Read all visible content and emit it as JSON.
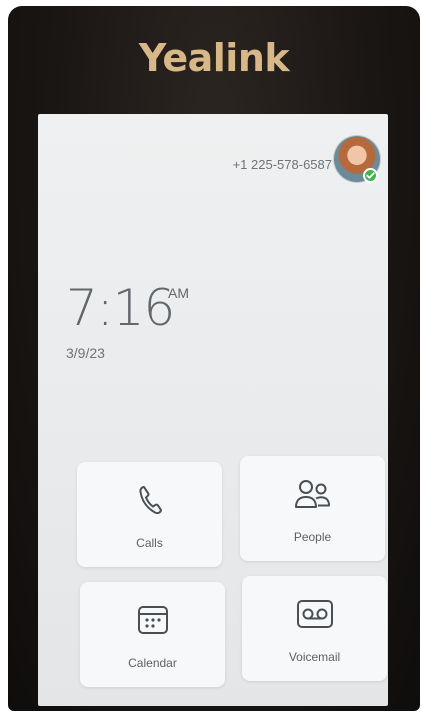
{
  "device": {
    "brand": "Yealink"
  },
  "status_bar": {
    "phone_number": "+1 225-578-6587",
    "presence": "available"
  },
  "clock": {
    "time": "7:16",
    "ampm": "AM",
    "date": "3/9/23"
  },
  "tiles": [
    {
      "label": "Calls",
      "icon": "phone-icon"
    },
    {
      "label": "People",
      "icon": "people-icon"
    },
    {
      "label": "Calendar",
      "icon": "calendar-icon"
    },
    {
      "label": "Voicemail",
      "icon": "voicemail-icon"
    }
  ],
  "colors": {
    "brand_gold": "#d8b889",
    "presence_green": "#3fb54a",
    "screen_bg": "#eef0f1",
    "tile_bg": "#f7f8f9"
  }
}
